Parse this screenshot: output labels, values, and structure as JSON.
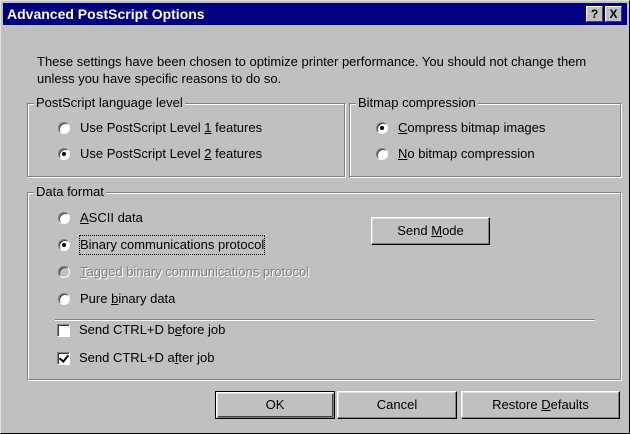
{
  "window": {
    "title": "Advanced PostScript Options",
    "help_label": "?",
    "close_label": "X"
  },
  "description": "These settings have been chosen to optimize printer performance. You should not change them unless you have specific reasons to do so.",
  "language_level": {
    "legend": "PostScript language level",
    "options": [
      {
        "pre": "Use PostScript Level ",
        "mnemonic": "1",
        "post": " features",
        "checked": false
      },
      {
        "pre": "Use PostScript Level ",
        "mnemonic": "2",
        "post": " features",
        "checked": true
      }
    ]
  },
  "bitmap_compression": {
    "legend": "Bitmap compression",
    "options": [
      {
        "pre": "",
        "mnemonic": "C",
        "post": "ompress bitmap images",
        "checked": true
      },
      {
        "pre": "",
        "mnemonic": "N",
        "post": "o bitmap compression",
        "checked": false
      }
    ]
  },
  "data_format": {
    "legend": "Data format",
    "options": [
      {
        "pre": "",
        "mnemonic": "A",
        "post": "SCII data",
        "checked": false,
        "disabled": false
      },
      {
        "pre": "Binary communications protocol",
        "mnemonic": "",
        "post": "",
        "checked": true,
        "disabled": false
      },
      {
        "pre": "",
        "mnemonic": "T",
        "post": "agged binary communications protocol",
        "checked": false,
        "disabled": true
      },
      {
        "pre": "Pure ",
        "mnemonic": "b",
        "post": "inary data",
        "checked": false,
        "disabled": false
      }
    ],
    "send_mode": {
      "pre": "Send ",
      "mnemonic": "M",
      "post": "ode"
    },
    "checkboxes": [
      {
        "pre": "Send CTRL+D b",
        "mnemonic": "e",
        "post": "fore job",
        "checked": false
      },
      {
        "pre": "Send CTRL+D a",
        "mnemonic": "f",
        "post": "ter job",
        "checked": true
      }
    ]
  },
  "buttons": {
    "ok": "OK",
    "cancel": "Cancel",
    "restore": {
      "pre": "Restore ",
      "mnemonic": "D",
      "post": "efaults"
    }
  }
}
